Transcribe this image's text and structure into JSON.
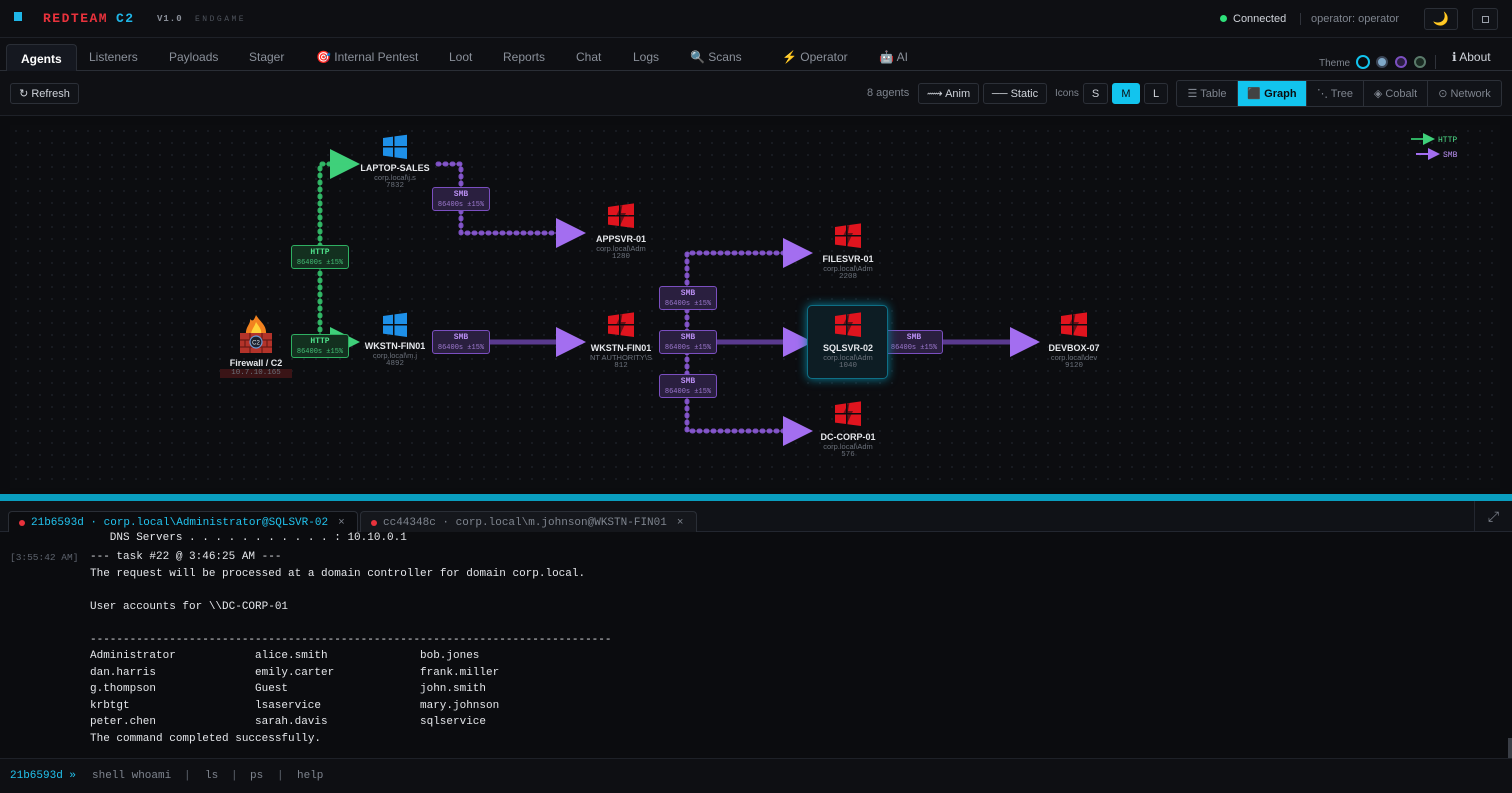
{
  "header": {
    "brand_red": "REDTEAM",
    "brand_c2": "C2",
    "version": "V1.0",
    "edition": "ENDGAME",
    "status": "Connected",
    "operator": "operator: operator"
  },
  "tabs": [
    {
      "label": "Agents",
      "icon": ""
    },
    {
      "label": "Listeners",
      "icon": ""
    },
    {
      "label": "Payloads",
      "icon": ""
    },
    {
      "label": "Stager",
      "icon": ""
    },
    {
      "label": "🎯 Internal Pentest",
      "icon": "target-icon"
    },
    {
      "label": "Loot",
      "icon": ""
    },
    {
      "label": "Reports",
      "icon": ""
    },
    {
      "label": "Chat",
      "icon": ""
    },
    {
      "label": "Logs",
      "icon": ""
    },
    {
      "label": "🔍 Scans",
      "icon": "search-icon"
    },
    {
      "label": "⚡ Operator",
      "icon": "bolt-icon"
    },
    {
      "label": "🤖 AI",
      "icon": "robot-icon"
    }
  ],
  "theme_label": "Theme",
  "theme_colors": [
    "#12c4ee",
    "#7fa8c8",
    "#7b4fc0",
    "#2fb062"
  ],
  "about": "ℹ About",
  "toolbar": {
    "refresh": "↻ Refresh",
    "agent_count": "8 agents",
    "anim": "⟿ Anim",
    "static": "── Static",
    "icons_label": "Icons",
    "sizes": [
      "S",
      "M",
      "L"
    ],
    "active_size": "M",
    "views": [
      "☰ Table",
      "⬛ Graph",
      "⋱ Tree",
      "◈ Cobalt",
      "⊙ Network"
    ],
    "active_view": "⬛ Graph"
  },
  "legend": {
    "http": "HTTP",
    "smb": "SMB"
  },
  "graph": {
    "c2": {
      "name": "Firewall / C2",
      "ip": "10.7.10.165"
    },
    "nodes": [
      {
        "id": "laptop",
        "name": "LAPTOP-SALES",
        "user": "corp.local\\j.s",
        "pid": "7832",
        "os": "windows"
      },
      {
        "id": "wkstn1",
        "name": "WKSTN-FIN01",
        "user": "corp.local\\m.j",
        "pid": "4892",
        "os": "windows"
      },
      {
        "id": "appsvr",
        "name": "APPSVR-01",
        "user": "corp.local\\Adm",
        "pid": "1280",
        "os": "windows-red"
      },
      {
        "id": "wkstn2",
        "name": "WKSTN-FIN01",
        "user": "NT AUTHORITY\\S",
        "pid": "812",
        "os": "windows-red"
      },
      {
        "id": "filesvr",
        "name": "FILESVR-01",
        "user": "corp.local\\Adm",
        "pid": "2208",
        "os": "windows-red"
      },
      {
        "id": "sqlsvr",
        "name": "SQLSVR-02",
        "user": "corp.local\\Adm",
        "pid": "1040",
        "os": "windows-red"
      },
      {
        "id": "dccorp",
        "name": "DC-CORP-01",
        "user": "corp.local\\Adm",
        "pid": "576",
        "os": "windows-red"
      },
      {
        "id": "devbox",
        "name": "DEVBOX-07",
        "user": "corp.local\\dev",
        "pid": "9120",
        "os": "windows-red"
      }
    ],
    "edges": [
      {
        "type": "HTTP",
        "sleep": "86400s ±15%"
      },
      {
        "type": "HTTP",
        "sleep": "86400s ±15%"
      },
      {
        "type": "SMB",
        "sleep": "86400s ±15%"
      },
      {
        "type": "SMB",
        "sleep": "86400s ±15%"
      },
      {
        "type": "SMB",
        "sleep": "86400s ±15%"
      },
      {
        "type": "SMB",
        "sleep": "86400s ±15%"
      },
      {
        "type": "SMB",
        "sleep": "86400s ±15%"
      },
      {
        "type": "SMB",
        "sleep": "86400s ±15%"
      }
    ]
  },
  "console_tabs": [
    {
      "label": "21b6593d · corp.local\\Administrator@SQLSVR-02",
      "close": "×"
    },
    {
      "label": "cc44348c · corp.local\\m.johnson@WKSTN-FIN01",
      "close": "×"
    }
  ],
  "console": {
    "dns_line": "   DNS Servers . . . . . . . . . . . : 10.10.0.1",
    "timestamp": "[3:55:42 AM]",
    "task_line": "--- task #22 @ 3:46:25 AM ---",
    "line1": "The request will be processed at a domain controller for domain corp.local.",
    "line2": "User accounts for \\\\DC-CORP-01",
    "rule": "-------------------------------------------------------------------------------",
    "accounts": [
      [
        "Administrator",
        "alice.smith",
        "bob.jones"
      ],
      [
        "dan.harris",
        "emily.carter",
        "frank.miller"
      ],
      [
        "g.thompson",
        "Guest",
        "john.smith"
      ],
      [
        "krbtgt",
        "lsaservice",
        "mary.johnson"
      ],
      [
        "peter.chen",
        "sarah.davis",
        "sqlservice"
      ]
    ],
    "done": "The command completed successfully."
  },
  "input": {
    "prompt": "21b6593d »",
    "hints": [
      "shell whoami",
      "|",
      "ls",
      "|",
      "ps",
      "|",
      "help"
    ]
  }
}
